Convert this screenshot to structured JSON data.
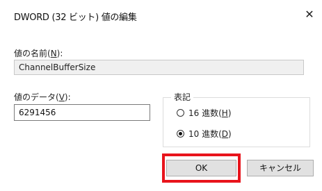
{
  "window": {
    "title": "DWORD (32 ビット) 値の編集",
    "close_glyph": "✕"
  },
  "value_name": {
    "label_prefix": "値の名前(",
    "label_key": "N",
    "label_suffix": "):",
    "value": "ChannelBufferSize"
  },
  "value_data": {
    "label_prefix": "値のデータ(",
    "label_key": "V",
    "label_suffix": "):",
    "value": "6291456"
  },
  "base": {
    "title": "表記",
    "options": [
      {
        "label_prefix": "16 進数(",
        "label_key": "H",
        "label_suffix": ")",
        "checked": false
      },
      {
        "label_prefix": "10 進数(",
        "label_key": "D",
        "label_suffix": ")",
        "checked": true
      }
    ]
  },
  "buttons": {
    "ok": "OK",
    "cancel": "キャンセル"
  },
  "colors": {
    "highlight": "#e8141c"
  }
}
